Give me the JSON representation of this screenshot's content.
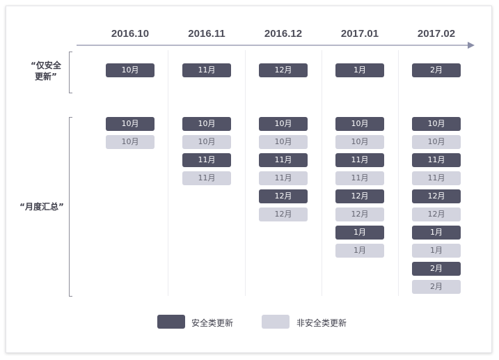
{
  "colors": {
    "security": "#525366",
    "non_security": "#d3d4df",
    "axis": "#8a8ea8"
  },
  "columns": [
    "2016.10",
    "2016.11",
    "2016.12",
    "2017.01",
    "2017.02"
  ],
  "rows": {
    "security_only": {
      "label_line1": "“仅安全",
      "label_line2": "更新”"
    },
    "monthly_rollup": {
      "label": "“月度汇总”"
    }
  },
  "security_only_tags": [
    "10月",
    "11月",
    "12月",
    "1月",
    "2月"
  ],
  "rollup_tags": [
    [
      {
        "text": "10月",
        "type": "security"
      },
      {
        "text": "10月",
        "type": "non_security"
      }
    ],
    [
      {
        "text": "10月",
        "type": "security"
      },
      {
        "text": "10月",
        "type": "non_security"
      },
      {
        "text": "11月",
        "type": "security"
      },
      {
        "text": "11月",
        "type": "non_security"
      }
    ],
    [
      {
        "text": "10月",
        "type": "security"
      },
      {
        "text": "10月",
        "type": "non_security"
      },
      {
        "text": "11月",
        "type": "security"
      },
      {
        "text": "11月",
        "type": "non_security"
      },
      {
        "text": "12月",
        "type": "security"
      },
      {
        "text": "12月",
        "type": "non_security"
      }
    ],
    [
      {
        "text": "10月",
        "type": "security"
      },
      {
        "text": "10月",
        "type": "non_security"
      },
      {
        "text": "11月",
        "type": "security"
      },
      {
        "text": "11月",
        "type": "non_security"
      },
      {
        "text": "12月",
        "type": "security"
      },
      {
        "text": "12月",
        "type": "non_security"
      },
      {
        "text": "1月",
        "type": "security"
      },
      {
        "text": "1月",
        "type": "non_security"
      }
    ],
    [
      {
        "text": "10月",
        "type": "security"
      },
      {
        "text": "10月",
        "type": "non_security"
      },
      {
        "text": "11月",
        "type": "security"
      },
      {
        "text": "11月",
        "type": "non_security"
      },
      {
        "text": "12月",
        "type": "security"
      },
      {
        "text": "12月",
        "type": "non_security"
      },
      {
        "text": "1月",
        "type": "security"
      },
      {
        "text": "1月",
        "type": "non_security"
      },
      {
        "text": "2月",
        "type": "security"
      },
      {
        "text": "2月",
        "type": "non_security"
      }
    ]
  ],
  "legend": {
    "security_label": "安全类更新",
    "non_security_label": "非安全类更新"
  }
}
